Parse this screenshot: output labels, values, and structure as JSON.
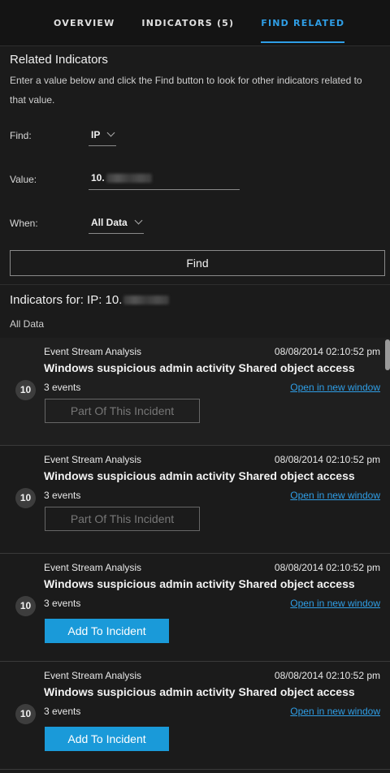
{
  "tabs": [
    {
      "label": "OVERVIEW",
      "active": false
    },
    {
      "label": "INDICATORS (5)",
      "active": false
    },
    {
      "label": "FIND RELATED",
      "active": true
    }
  ],
  "colors": {
    "accent": "#2f9ee6",
    "primary_button": "#1a9ad9",
    "background": "#1b1b1b"
  },
  "related": {
    "title": "Related Indicators",
    "description": "Enter a value below and click the Find button to look for other indicators related to that value.",
    "find_label": "Find:",
    "find_value": "IP",
    "value_label": "Value:",
    "value_text": "10.",
    "when_label": "When:",
    "when_value": "All Data",
    "find_button": "Find"
  },
  "results": {
    "title": "Indicators for: IP: 10.",
    "subtitle": "All Data",
    "items": [
      {
        "badge": "10",
        "source": "Event Stream Analysis",
        "date": "08/08/2014 02:10:52 pm",
        "title": "Windows suspicious admin activity Shared object access",
        "events": "3 events",
        "link": "Open in new window",
        "action": "Part Of This Incident",
        "action_type": "disabled"
      },
      {
        "badge": "10",
        "source": "Event Stream Analysis",
        "date": "08/08/2014 02:10:52 pm",
        "title": "Windows suspicious admin activity Shared object access",
        "events": "3 events",
        "link": "Open in new window",
        "action": "Part Of This Incident",
        "action_type": "disabled"
      },
      {
        "badge": "10",
        "source": "Event Stream Analysis",
        "date": "08/08/2014 02:10:52 pm",
        "title": "Windows suspicious admin activity Shared object access",
        "events": "3 events",
        "link": "Open in new window",
        "action": "Add To Incident",
        "action_type": "primary"
      },
      {
        "badge": "10",
        "source": "Event Stream Analysis",
        "date": "08/08/2014 02:10:52 pm",
        "title": "Windows suspicious admin activity Shared object access",
        "events": "3 events",
        "link": "Open in new window",
        "action": "Add To Incident",
        "action_type": "primary"
      }
    ]
  }
}
